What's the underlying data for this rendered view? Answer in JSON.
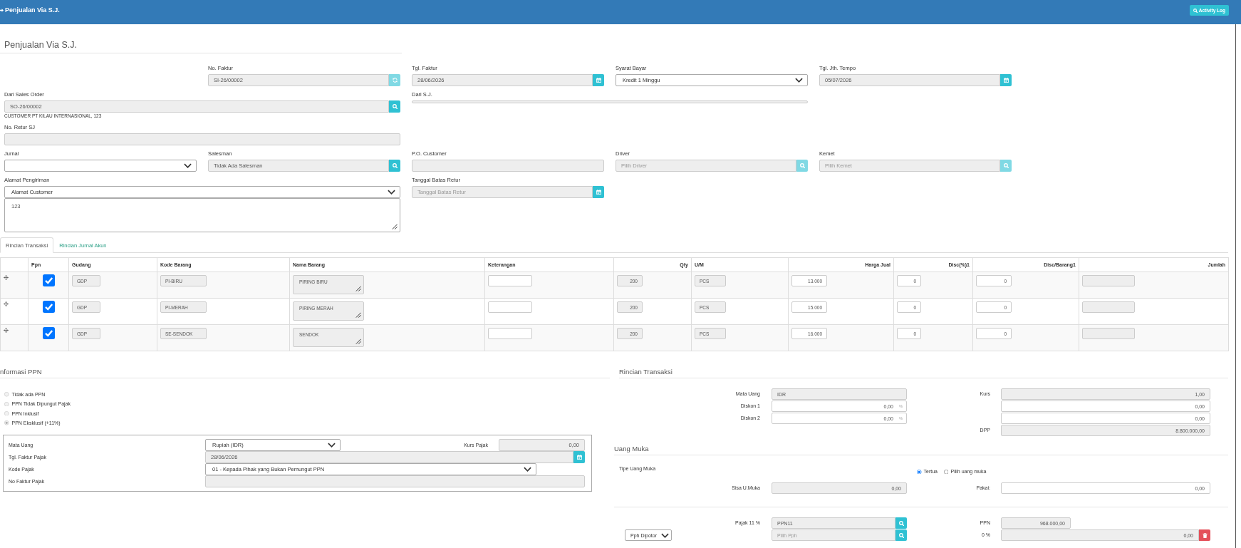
{
  "header": {
    "title": "Penjualan Via S.J.",
    "action_button": "Activity Log"
  },
  "page_title": "Penjualan Via S.J.",
  "form": {
    "no_faktur": {
      "label": "No. Faktur",
      "value": "SI-26/00002",
      "readonly": true,
      "addon": {
        "kind": "refresh",
        "disabled": true
      }
    },
    "tgl_faktur": {
      "label": "Tgl. Faktur",
      "value": "28/06/2026",
      "readonly": true,
      "addon": {
        "kind": "calendar",
        "disabled": false
      }
    },
    "syarat_bayar": {
      "label": "Syarat Bayar",
      "value": "Kredit 1 Minggu"
    },
    "tgl_jth_tempo": {
      "label": "Tgl. Jth. Tempo",
      "value": "05/07/2026",
      "readonly": true,
      "addon": {
        "kind": "calendar",
        "disabled": false
      }
    },
    "dari_sales_order": {
      "label": "Dari Sales Order",
      "value": "SO-26/00002",
      "readonly": true,
      "addon": {
        "kind": "search",
        "disabled": false
      },
      "note": "CUSTOMER PT KILAU INTERNASIONAL, 123"
    },
    "dari_sj": {
      "label": "Dari S.J."
    },
    "no_retur_sj": {
      "label": "No. Retur SJ",
      "readonly": true
    },
    "jurnal": {
      "label": "Jurnal"
    },
    "salesman": {
      "label": "Salesman",
      "value": "Tidak Ada Salesman",
      "readonly": true,
      "addon": {
        "kind": "search",
        "disabled": false
      }
    },
    "po_customer": {
      "label": "P.O. Customer",
      "readonly": true
    },
    "driver": {
      "label": "Driver",
      "placeholder": "Pilih Driver",
      "readonly": true,
      "addon": {
        "kind": "search",
        "disabled": true
      }
    },
    "kemet": {
      "label": "Kemet",
      "placeholder": "Pilih Kemet",
      "readonly": true,
      "addon": {
        "kind": "search",
        "disabled": true
      }
    },
    "alamat_pengiriman": {
      "label": "Alamat Pengiriman",
      "value": "Alamat Customer",
      "address": "123"
    },
    "tanggal_batas_retur": {
      "label": "Tanggal Batas Retur",
      "placeholder": "Tanggal Batas Retur",
      "readonly": true,
      "addon": {
        "kind": "calendar",
        "disabled": false
      }
    }
  },
  "tabs": [
    {
      "label": "Rincian Transaksi",
      "selected": true
    },
    {
      "label": "Rincian Jurnal Akun",
      "selected": false
    }
  ],
  "table": {
    "columns": [
      {
        "label": "Ppn",
        "kind": "checkbox"
      },
      {
        "label": "Gudang",
        "kind": "input",
        "readonly": true
      },
      {
        "label": "Kode Barang",
        "kind": "input",
        "readonly": true
      },
      {
        "label": "Nama Barang",
        "kind": "textarea",
        "readonly": true
      },
      {
        "label": "Keterangan",
        "kind": "input",
        "readonly": false
      },
      {
        "label": "Qty",
        "kind": "input",
        "readonly": true
      },
      {
        "label": "U/M",
        "kind": "input",
        "readonly": true
      },
      {
        "label": "Harga Jual",
        "kind": "input",
        "readonly": false
      },
      {
        "label": "Disc(%)1",
        "kind": "input",
        "readonly": false
      },
      {
        "label": "Disc/Barang1",
        "kind": "input",
        "readonly": false
      },
      {
        "label": "Jumlah",
        "kind": "input",
        "readonly": true
      }
    ],
    "rows": [
      {
        "cells": [
          {
            "checked": true
          },
          {
            "value": "GDP"
          },
          {
            "value": "PI-BIRU"
          },
          {
            "value": "PIRING BIRU"
          },
          null,
          {
            "value": "200"
          },
          {
            "value": "PCS"
          },
          {
            "value": "13.000"
          },
          {
            "value": "0"
          },
          {
            "value": "0"
          },
          null
        ]
      },
      {
        "cells": [
          {
            "checked": true
          },
          {
            "value": "GDP"
          },
          {
            "value": "PI-MERAH"
          },
          {
            "value": "PIRING MERAH"
          },
          null,
          {
            "value": "200"
          },
          {
            "value": "PCS"
          },
          {
            "value": "15.000"
          },
          {
            "value": "0"
          },
          {
            "value": "0"
          },
          null
        ]
      },
      {
        "cells": [
          {
            "checked": true
          },
          {
            "value": "GDP"
          },
          {
            "value": "SE-SENDOK"
          },
          {
            "value": "SENDOK"
          },
          null,
          {
            "value": "200"
          },
          {
            "value": "PCS"
          },
          {
            "value": "16.000"
          },
          {
            "value": "0"
          },
          {
            "value": "0"
          },
          null
        ]
      }
    ]
  },
  "ppn_info": {
    "title": "nformasi PPN",
    "options": [
      {
        "label": "Tidak ada PPN",
        "selected": false,
        "disabled": true
      },
      {
        "label": "PPN Tidak Dipungut Pajak",
        "selected": false,
        "disabled": true
      },
      {
        "label": "PPN Inklusif",
        "selected": false,
        "disabled": true
      },
      {
        "label": "PPN Eksklusif (+11%)",
        "selected": true,
        "disabled": true
      }
    ],
    "mata_uang": {
      "label": "Mata Uang",
      "value": "Rupiah (IDR)"
    },
    "kurs_pajak": {
      "label": "Kurs Pajak",
      "value": "0,00",
      "readonly": true
    },
    "tgl_faktur_pajak": {
      "label": "Tgl. Faktur Pajak",
      "value": "28/06/2026",
      "readonly": true,
      "addon": {
        "kind": "calendar",
        "disabled": false
      }
    },
    "kode_pajak": {
      "label": "Kode Pajak",
      "value": "01 - Kepada Pihak yang Bukan Pemungut PPN"
    },
    "no_faktur_pajak": {
      "label": "No Faktur Pajak",
      "readonly": true
    }
  },
  "summary": {
    "title": "Rincian Transaksi",
    "mata_uang": {
      "label": "Mata Uang",
      "value": "IDR",
      "readonly": true
    },
    "kurs": {
      "label": "Kurs",
      "value": "1,00",
      "readonly": true
    },
    "diskon_1": {
      "label": "Diskon 1",
      "value": "0,00",
      "suffix": "%",
      "readonly": false
    },
    "diskon_1_nominal": {
      "value": "0,00",
      "readonly": false
    },
    "diskon_2": {
      "label": "Diskon 2",
      "value": "0,00",
      "suffix": "%",
      "readonly": false
    },
    "diskon_2_nominal": {
      "value": "0,00",
      "readonly": false
    },
    "dpp": {
      "label": "DPP",
      "value": "8.800.000,00",
      "readonly": true
    }
  },
  "uang_muka": {
    "title": "Uang Muka",
    "tipe_label": "Tipe Uang Muka",
    "options": [
      {
        "label": "Tertua",
        "selected": true,
        "disabled": false
      },
      {
        "label": "Pilih uang muka",
        "selected": false,
        "disabled": false
      }
    ],
    "sisa": {
      "label": "Sisa U.Muka",
      "value": "0,00",
      "readonly": true
    },
    "pakai": {
      "label": "Pakai:",
      "value": "0,00",
      "readonly": false
    }
  },
  "tax": {
    "pajak": {
      "label": "Pajak 11 %",
      "value": "PPN11",
      "readonly": true,
      "addon": {
        "kind": "search",
        "disabled": false
      }
    },
    "ppn": {
      "label": "PPN",
      "value": "968.000,00",
      "readonly": true
    },
    "pph_type": {
      "value": "Pph Dipotor"
    },
    "pph": {
      "placeholder": "Pilih Pph",
      "readonly": true,
      "addon": {
        "kind": "search",
        "disabled": false
      }
    },
    "pph_nominal": {
      "label": "0 %",
      "value": "0,00",
      "readonly": true,
      "addon": {
        "kind": "delete",
        "disabled": false
      }
    }
  }
}
